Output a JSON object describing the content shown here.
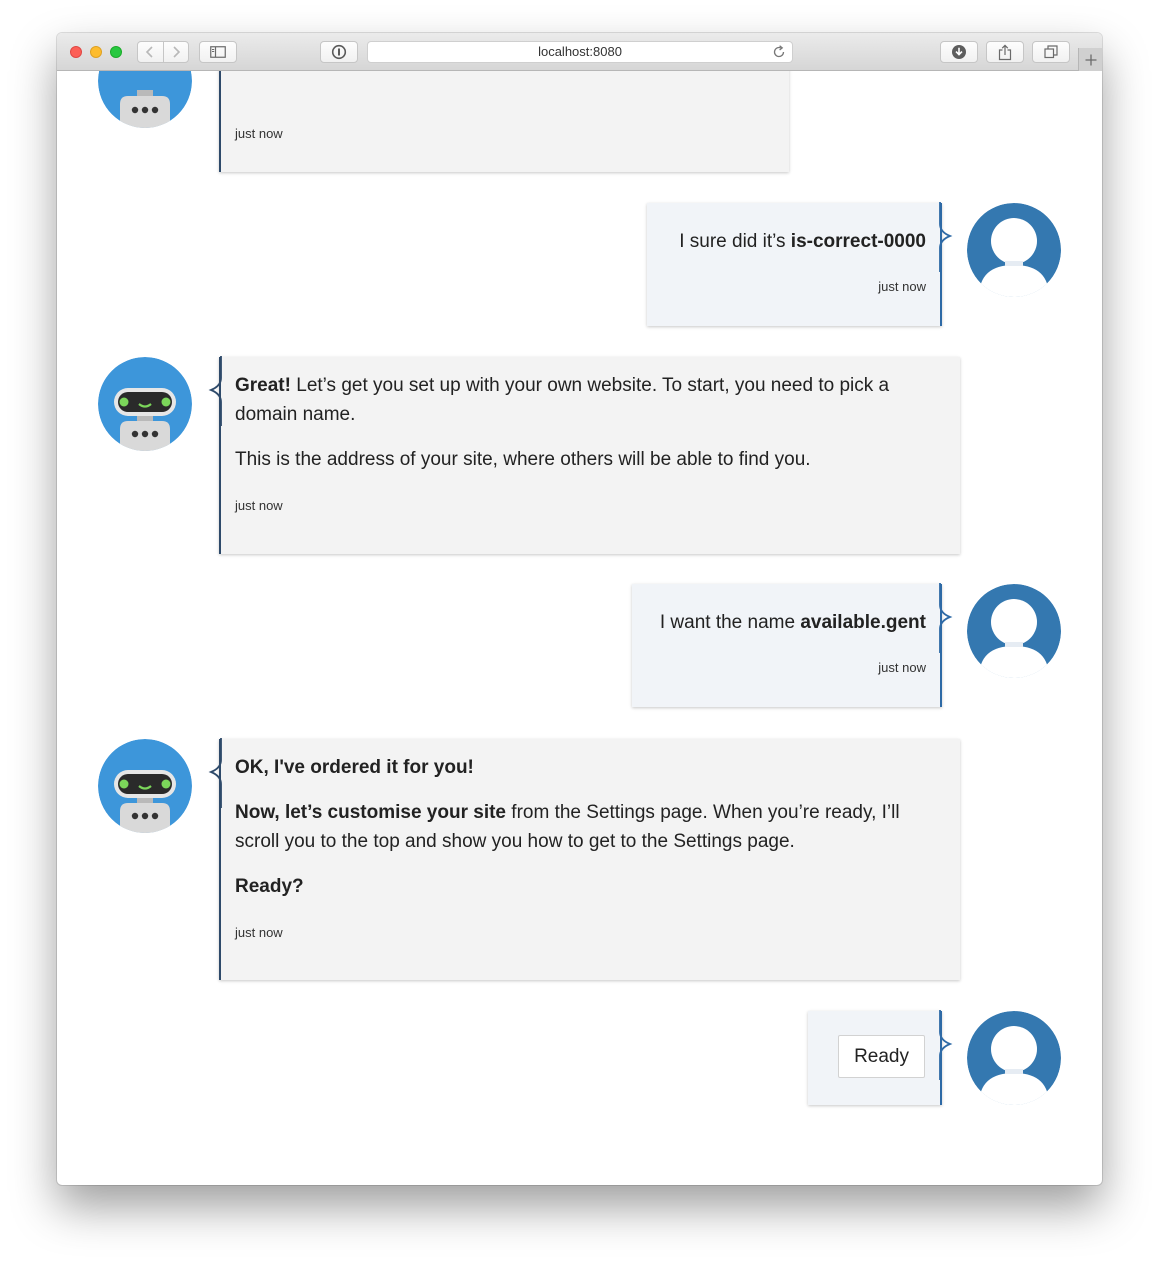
{
  "browser": {
    "url": "localhost:8080"
  },
  "messages": [
    {
      "sender": "bot",
      "timestamp": "just now"
    },
    {
      "sender": "user",
      "text": "I sure did it’s ",
      "bold": "is-correct-0000",
      "timestamp": "just now"
    },
    {
      "sender": "bot",
      "p1_bold": "Great!",
      "p1_text": " Let’s get you set up with your own website. To start, you need to pick a domain name.",
      "p2_text": "This is the address of your site, where others will be able to find you.",
      "timestamp": "just now"
    },
    {
      "sender": "user",
      "text": "I want the name ",
      "bold": "available.gent",
      "timestamp": "just now"
    },
    {
      "sender": "bot",
      "p1_bold": "OK, I've ordered it for you!",
      "p2_bold": "Now, let’s customise your site",
      "p2_text": " from the Settings page. When you’re ready, I’ll scroll you to the top and show you how to get to the Settings page.",
      "p3_bold": "Ready?",
      "timestamp": "just now"
    },
    {
      "sender": "user",
      "button_label": "Ready"
    }
  ],
  "colors": {
    "bot_avatar_bg": "#3d96da",
    "user_avatar_bg": "#3478b0",
    "bot_bubble_bg": "#f3f3f3",
    "user_bubble_bg": "#f1f4f8"
  }
}
